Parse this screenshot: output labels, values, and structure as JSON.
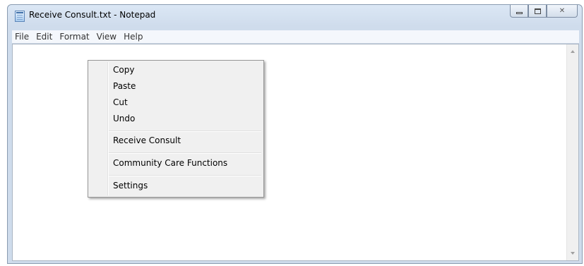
{
  "window": {
    "title": "Receive Consult.txt - Notepad",
    "icon": "notepad-icon",
    "caption_buttons": {
      "minimize_icon": "minimize-icon",
      "maximize_icon": "maximize-icon",
      "close_glyph": "✕"
    }
  },
  "menubar": {
    "items": [
      "File",
      "Edit",
      "Format",
      "View",
      "Help"
    ]
  },
  "editor": {
    "content": ""
  },
  "context_menu": {
    "items": [
      "Copy",
      "Paste",
      "Cut",
      "Undo"
    ],
    "receive_consult": "Receive Consult",
    "community_care": "Community Care Functions",
    "settings": "Settings"
  },
  "colors": {
    "titlebar": "#dbe7f5",
    "menu_bg": "#f0f0f0",
    "border": "#8a9bb0"
  }
}
